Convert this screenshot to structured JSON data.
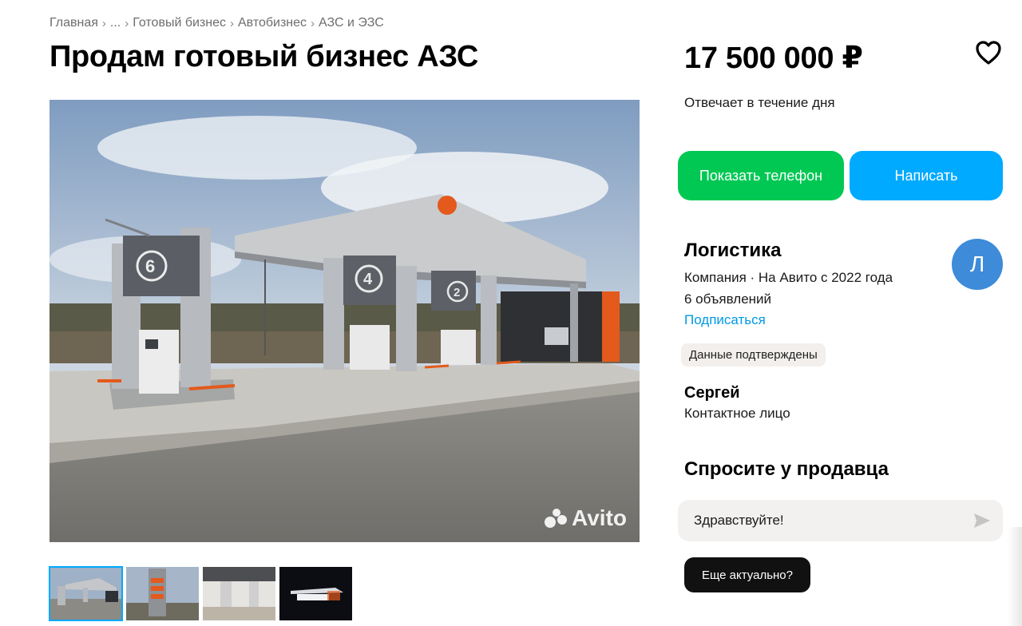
{
  "breadcrumb": {
    "items": [
      "Главная",
      "...",
      "Готовый бизнес",
      "Автобизнес",
      "АЗС и ЭЗС"
    ],
    "separator": "›"
  },
  "listing": {
    "title": "Продам готовый бизнес АЗС",
    "price": "17 500 000 ₽",
    "responds": "Отвечает в течение дня",
    "photo_watermark": "Avito",
    "photo_count": 4,
    "active_photo": 1
  },
  "actions": {
    "show_phone": "Показать телефон",
    "write": "Написать",
    "colors": {
      "phone": "#00c853",
      "write": "#00aaff"
    }
  },
  "seller": {
    "name": "Логистика",
    "meta": "Компания · На Авито с 2022 года",
    "listings_count": "6 объявлений",
    "subscribe": "Подписаться",
    "avatar_letter": "Л",
    "verified": "Данные подтверждены"
  },
  "contact": {
    "name": "Сергей",
    "role": "Контактное лицо"
  },
  "ask": {
    "title": "Спросите у продавца",
    "input_value": "Здравствуйте!",
    "quick_reply": "Еще актуально?"
  },
  "icons": {
    "favorite": "heart-icon",
    "send": "send-icon"
  }
}
